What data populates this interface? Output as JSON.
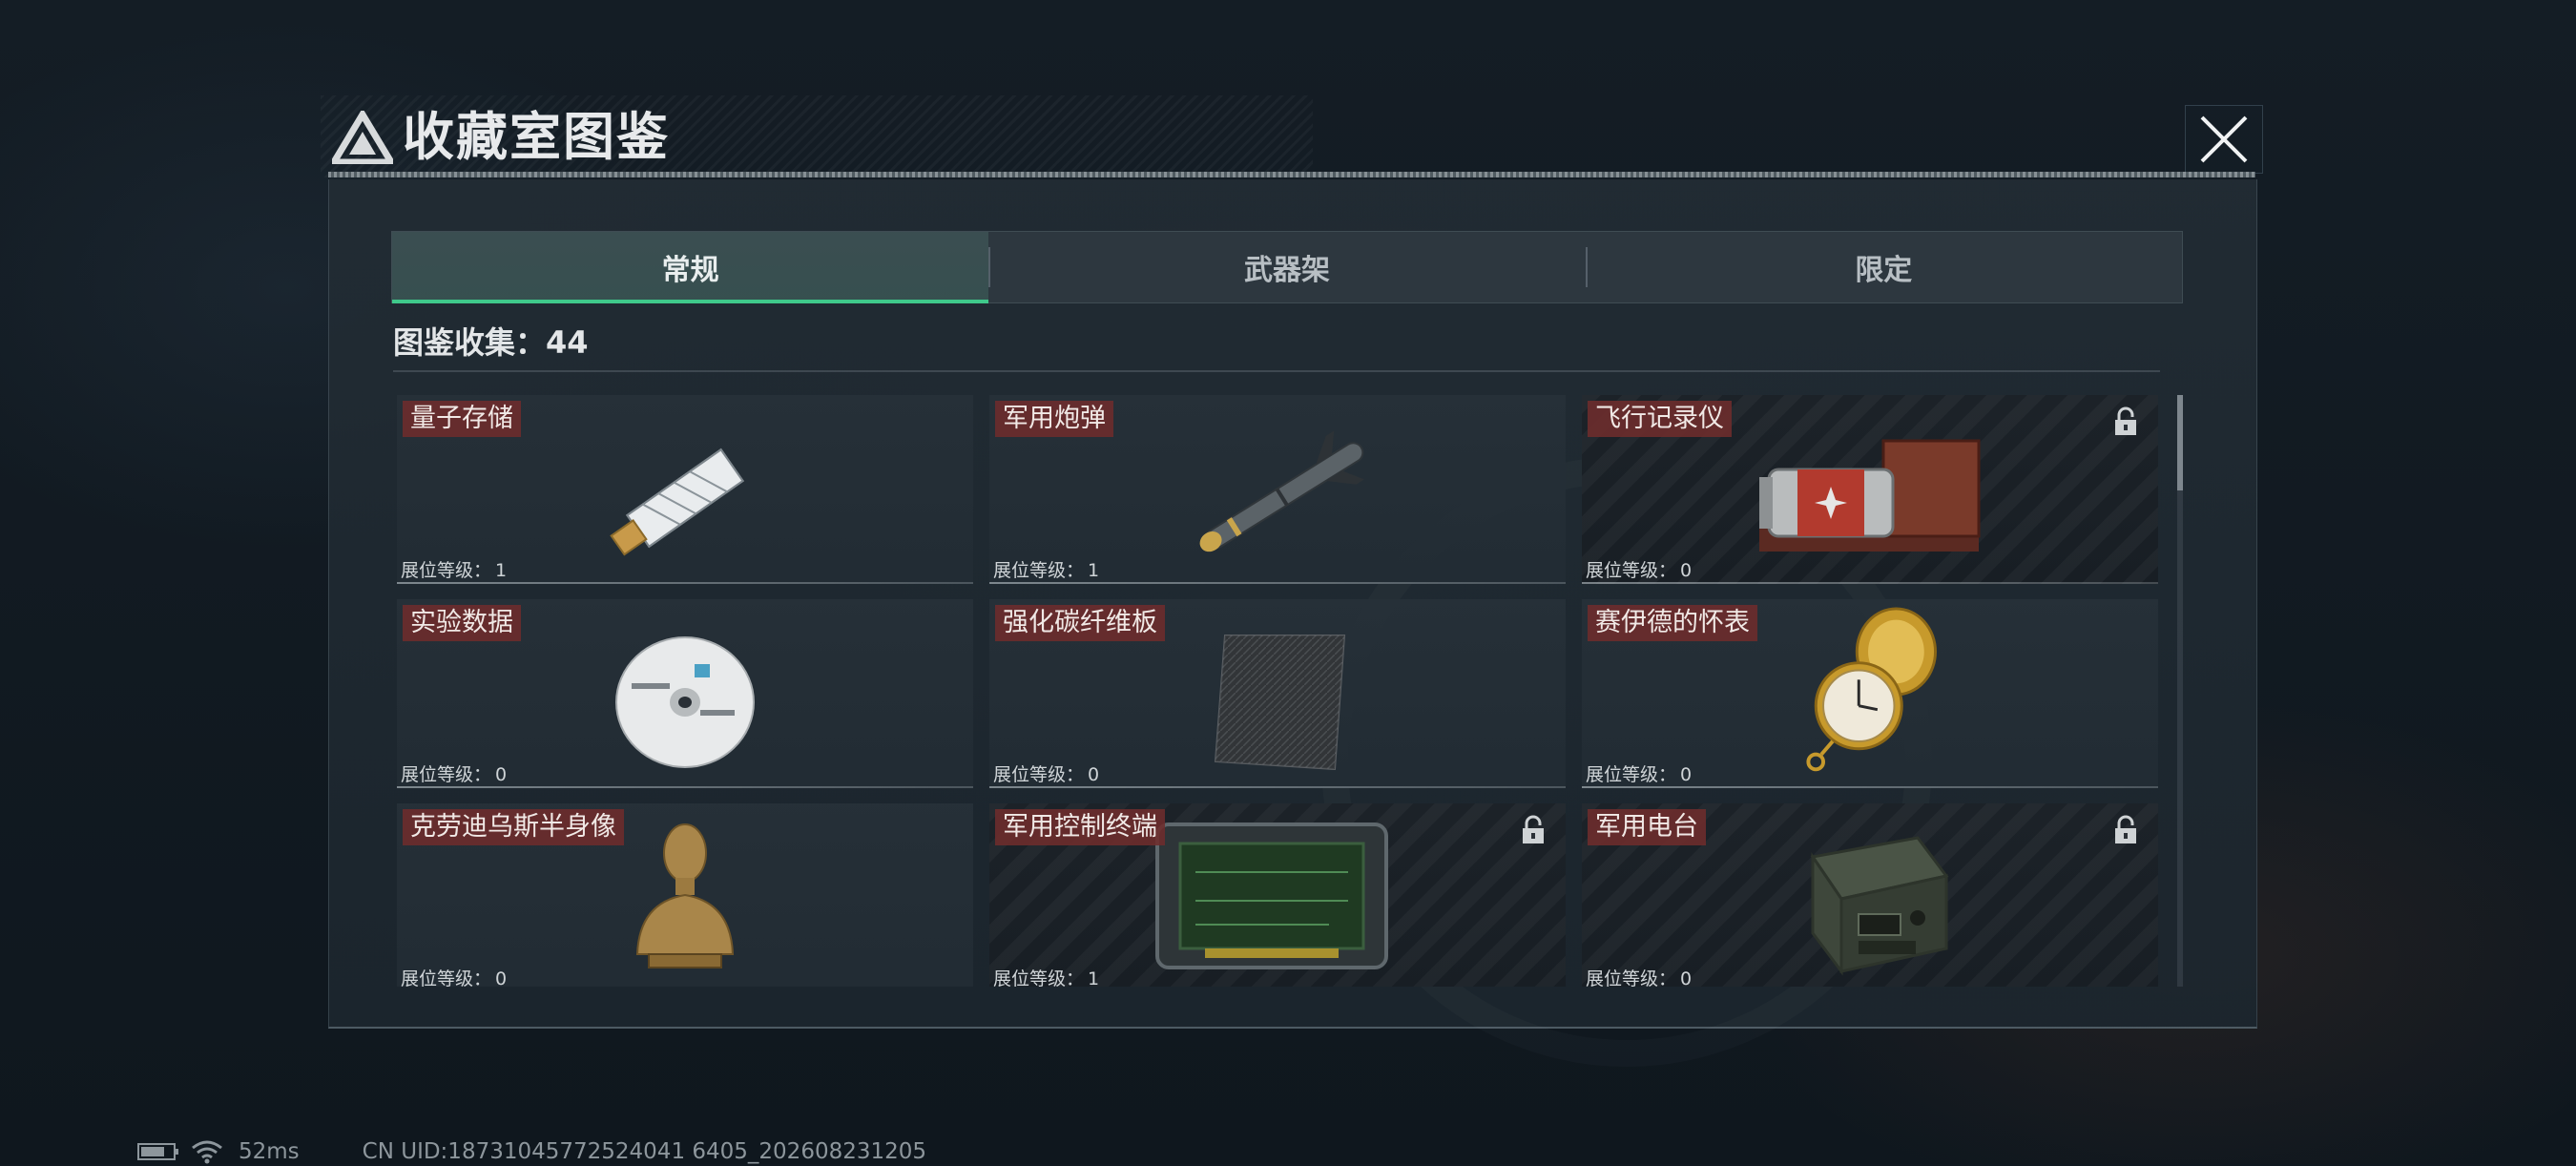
{
  "window": {
    "title": "收藏室图鉴",
    "close_icon": "close-icon"
  },
  "tabs": [
    {
      "label": "常规",
      "active": true
    },
    {
      "label": "武器架",
      "active": false
    },
    {
      "label": "限定",
      "active": false
    }
  ],
  "collection": {
    "label": "图鉴收集：",
    "count": "44"
  },
  "level_label": "展位等级：",
  "items": [
    {
      "name": "量子存储",
      "level": "1",
      "locked": false,
      "icon": "usb-drive-icon"
    },
    {
      "name": "军用炮弹",
      "level": "1",
      "locked": false,
      "icon": "missile-icon"
    },
    {
      "name": "飞行记录仪",
      "level": "0",
      "locked": true,
      "icon": "flight-recorder-icon"
    },
    {
      "name": "实验数据",
      "level": "0",
      "locked": false,
      "icon": "disc-icon"
    },
    {
      "name": "强化碳纤维板",
      "level": "0",
      "locked": false,
      "icon": "carbon-plate-icon"
    },
    {
      "name": "赛伊德的怀表",
      "level": "0",
      "locked": false,
      "icon": "pocket-watch-icon"
    },
    {
      "name": "克劳迪乌斯半身像",
      "level": "0",
      "locked": false,
      "icon": "bust-icon"
    },
    {
      "name": "军用控制终端",
      "level": "1",
      "locked": true,
      "icon": "control-terminal-icon"
    },
    {
      "name": "军用电台",
      "level": "0",
      "locked": true,
      "icon": "radio-icon"
    }
  ],
  "status_bar": {
    "ping": "52ms",
    "uid": "CN UID:18731045772524041 6405_202608231205",
    "battery_icon": "battery-icon",
    "wifi_icon": "wifi-icon"
  },
  "colors": {
    "accent_green": "#3fc98b",
    "name_tag": "#6e2c2c"
  }
}
